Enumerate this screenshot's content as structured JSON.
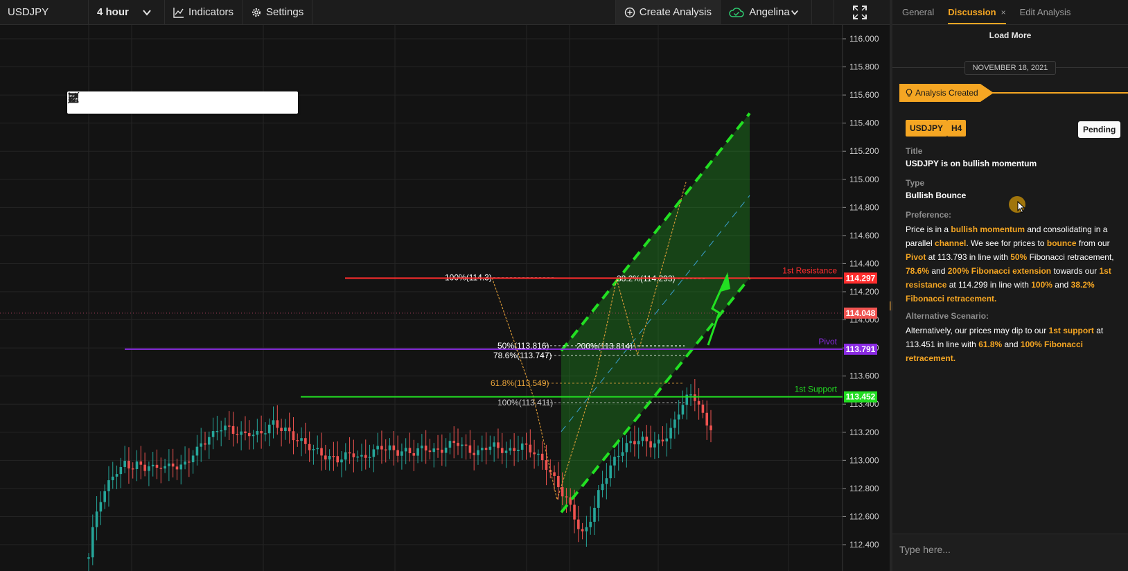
{
  "toolbar": {
    "symbol": "USDJPY",
    "interval": "4 hour",
    "indicators_label": "Indicators",
    "settings_label": "Settings",
    "create_label": "Create Analysis",
    "user_name": "Angelina"
  },
  "drawing_tools": [
    "drag-handle-icon",
    "horizontal-lines-icon",
    "horizontal-ray-icon",
    "trend-line-icon",
    "ray-line-icon",
    "extended-line-icon",
    "fibonacci-icon",
    "parallel-channel-icon",
    "rectangle-icon"
  ],
  "chart_data": {
    "type": "candlestick",
    "symbol": "USDJPY",
    "timeframe": "H4",
    "y_ticks": [
      116.0,
      115.8,
      115.6,
      115.4,
      115.2,
      115.0,
      114.8,
      114.6,
      114.4,
      114.2,
      114.0,
      113.8,
      113.6,
      113.4,
      113.2,
      113.0,
      112.8,
      112.6,
      112.4
    ],
    "y_tick_labels": [
      "116.000",
      "115.800",
      "115.600",
      "115.400",
      "115.200",
      "115.000",
      "114.800",
      "114.600",
      "114.400",
      "114.200",
      "114.000",
      "113.800",
      "113.600",
      "113.400",
      "113.200",
      "113.000",
      "112.800",
      "112.600",
      "112.400"
    ],
    "ylim": [
      112.25,
      116.2
    ],
    "current_price": "114.048",
    "colors": {
      "up": "#26a69a",
      "down": "#ef5350",
      "channel": "#22e022",
      "resistance": "#ff2d2d",
      "pivot": "#8a2be2",
      "support": "#22dd22",
      "fib": "#e8a33a"
    },
    "levels": [
      {
        "name": "1st Resistance",
        "value": 114.297,
        "price_label": "114.297",
        "color": "#ff2d2d"
      },
      {
        "name": "Pivot",
        "value": 113.791,
        "price_label": "113.791",
        "color": "#8a2be2"
      },
      {
        "name": "1st Support",
        "value": 113.452,
        "price_label": "113.452",
        "color": "#22dd22"
      }
    ],
    "fib_labels": [
      {
        "text": "100%(114.3)",
        "value": 114.3
      },
      {
        "text": "38.2%(114.293)",
        "value": 114.293
      },
      {
        "text": "50%(113.816)",
        "value": 113.816
      },
      {
        "text": "200%(113.814)",
        "value": 113.814
      },
      {
        "text": "78.6%(113.747)",
        "value": 113.747
      },
      {
        "text": "61.8%(113.549)",
        "value": 113.549
      },
      {
        "text": "100%(113.411)",
        "value": 113.411
      }
    ],
    "channel": {
      "lower_start": 112.63,
      "lower_end": 114.3,
      "upper_start": 113.78,
      "upper_end": 115.47
    },
    "candles": {
      "start_price": 112.3,
      "drift": [
        0.01,
        0.18,
        0.12,
        0.1,
        0.06,
        0.05,
        0.05,
        0.04,
        0.02,
        0.03,
        -0.02,
        0.0,
        0.02,
        -0.02,
        -0.01,
        0.02,
        -0.02,
        0.0,
        0.02,
        -0.01,
        0.0,
        0.01,
        -0.01,
        0.0,
        0.02,
        0.03,
        0.04,
        0.03,
        0.04,
        0.02,
        0.03,
        0.02,
        0.03,
        0.02,
        0.0,
        -0.01,
        -0.02,
        -0.01,
        -0.01,
        0.0,
        0.01,
        -0.01,
        0.0,
        0.01,
        0.02,
        0.03,
        0.02,
        -0.02,
        -0.02,
        -0.01,
        -0.02,
        -0.03,
        -0.02,
        -0.01,
        -0.02,
        -0.02,
        -0.02,
        -0.01,
        -0.02,
        -0.02,
        -0.01,
        0.0,
        -0.01,
        0.01,
        0.02,
        0.01,
        0.0,
        -0.02,
        -0.01,
        0.01,
        0.02,
        0.02,
        0.02,
        0.01,
        -0.01,
        0.0,
        -0.02,
        -0.01,
        0.01,
        0.0,
        -0.01,
        0.0,
        0.02,
        0.01,
        0.0,
        -0.01,
        -0.01,
        0.0,
        0.01,
        0.02,
        0.02,
        0.01,
        0.0,
        -0.02,
        -0.02,
        -0.02,
        -0.01,
        0.0,
        0.02,
        0.02,
        0.01,
        0.0,
        -0.02,
        -0.01,
        -0.01,
        0.0,
        0.01,
        0.02,
        0.01,
        -0.01,
        -0.02,
        -0.02,
        -0.03,
        -0.03,
        -0.04,
        -0.04,
        -0.05,
        -0.05,
        -0.05,
        -0.04,
        -0.06,
        -0.07,
        -0.07,
        -0.05,
        0.04,
        0.07,
        0.08,
        0.1,
        0.07,
        0.06,
        0.06,
        0.05,
        0.04,
        0.03,
        0.03,
        0.02,
        0.01,
        0.01,
        0.0,
        -0.01,
        -0.02,
        0.0,
        0.01,
        0.02,
        0.03,
        0.04,
        0.06,
        0.07,
        0.06,
        0.04,
        0.02,
        -0.02,
        -0.05,
        -0.08,
        -0.06,
        -0.02
      ]
    }
  },
  "panel": {
    "tabs": {
      "general": "General",
      "discussion": "Discussion",
      "close_glyph": "×",
      "edit": "Edit Analysis"
    },
    "load_more": "Load More",
    "date": "NOVEMBER 18, 2021",
    "event": "Analysis Created",
    "symbol_chip": "USDJPY",
    "timeframe_chip": "H4",
    "status": "Pending",
    "title_label": "Title",
    "title_value": "USDJPY is on bullish momentum",
    "type_label": "Type",
    "type_value": "Bullish Bounce",
    "preference_label": "Preference:",
    "preference": {
      "t1": "Price is in a ",
      "h1": "bullish momentum",
      "t2": " and consolidating in a parallel ",
      "h2": "channel",
      "t3": ". We see for prices to ",
      "h3": "bounce",
      "t4": " from our ",
      "h4": "Pivot",
      "t5": " at 113.793 in line with ",
      "h5": "50%",
      "t6": " Fibonacci retracement, ",
      "h6": "78.6%",
      "t7": " and ",
      "h7": "200% Fibonacci extension",
      "t8": " towards our ",
      "h8": "1st resistance",
      "t9": " at 114.299 in line with ",
      "h9": "100%",
      "t10": " and ",
      "h10": "38.2% Fibonacci retracement."
    },
    "alt_label": "Alternative Scenario:",
    "alternative": {
      "t1": "Alternatively, our prices may dip to our ",
      "h1": "1st support",
      "t2": " at 113.451 in line with ",
      "h2": "61.8%",
      "t3": " and ",
      "h3": "100% Fibonacci retracement."
    },
    "chat_placeholder": "Type here..."
  }
}
